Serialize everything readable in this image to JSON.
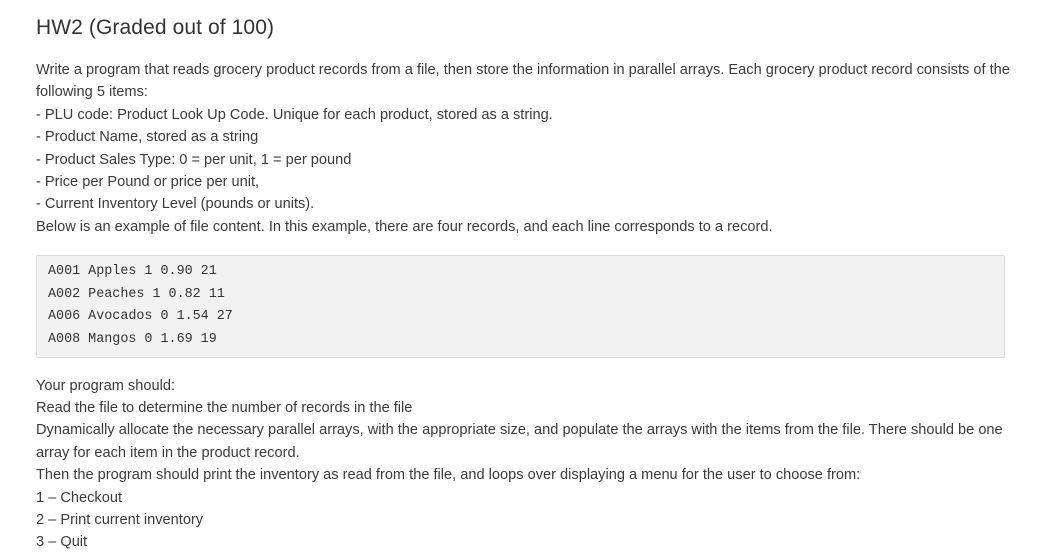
{
  "title": "HW2 (Graded out of 100)",
  "intro": [
    "Write a program that reads grocery product records from a file, then store the information in parallel arrays. Each grocery product record consists of the following 5 items:",
    "- PLU code: Product Look Up Code. Unique for each product, stored as a string.",
    "- Product Name, stored as a string",
    "- Product Sales Type: 0 = per unit, 1 = per pound",
    "- Price per Pound or price per unit,",
    "- Current Inventory Level (pounds or units).",
    "Below is an example of file content. In this example, there are four records, and each line corresponds to a record."
  ],
  "code_lines": [
    "A001 Apples 1 0.90 21",
    "A002 Peaches 1 0.82 11",
    "A006 Avocados 0 1.54 27",
    "A008 Mangos 0 1.69 19"
  ],
  "outro": [
    "Your program should:",
    "Read the file to determine the number of records in the file",
    "Dynamically allocate the necessary parallel arrays, with the appropriate size, and populate the arrays with the items from the file. There should be one array for each item in the product record.",
    "Then the program should print the inventory as read from the file, and loops over displaying a menu for the user to choose from:",
    "1 – Checkout",
    "2 – Print current inventory",
    "3 – Quit"
  ]
}
